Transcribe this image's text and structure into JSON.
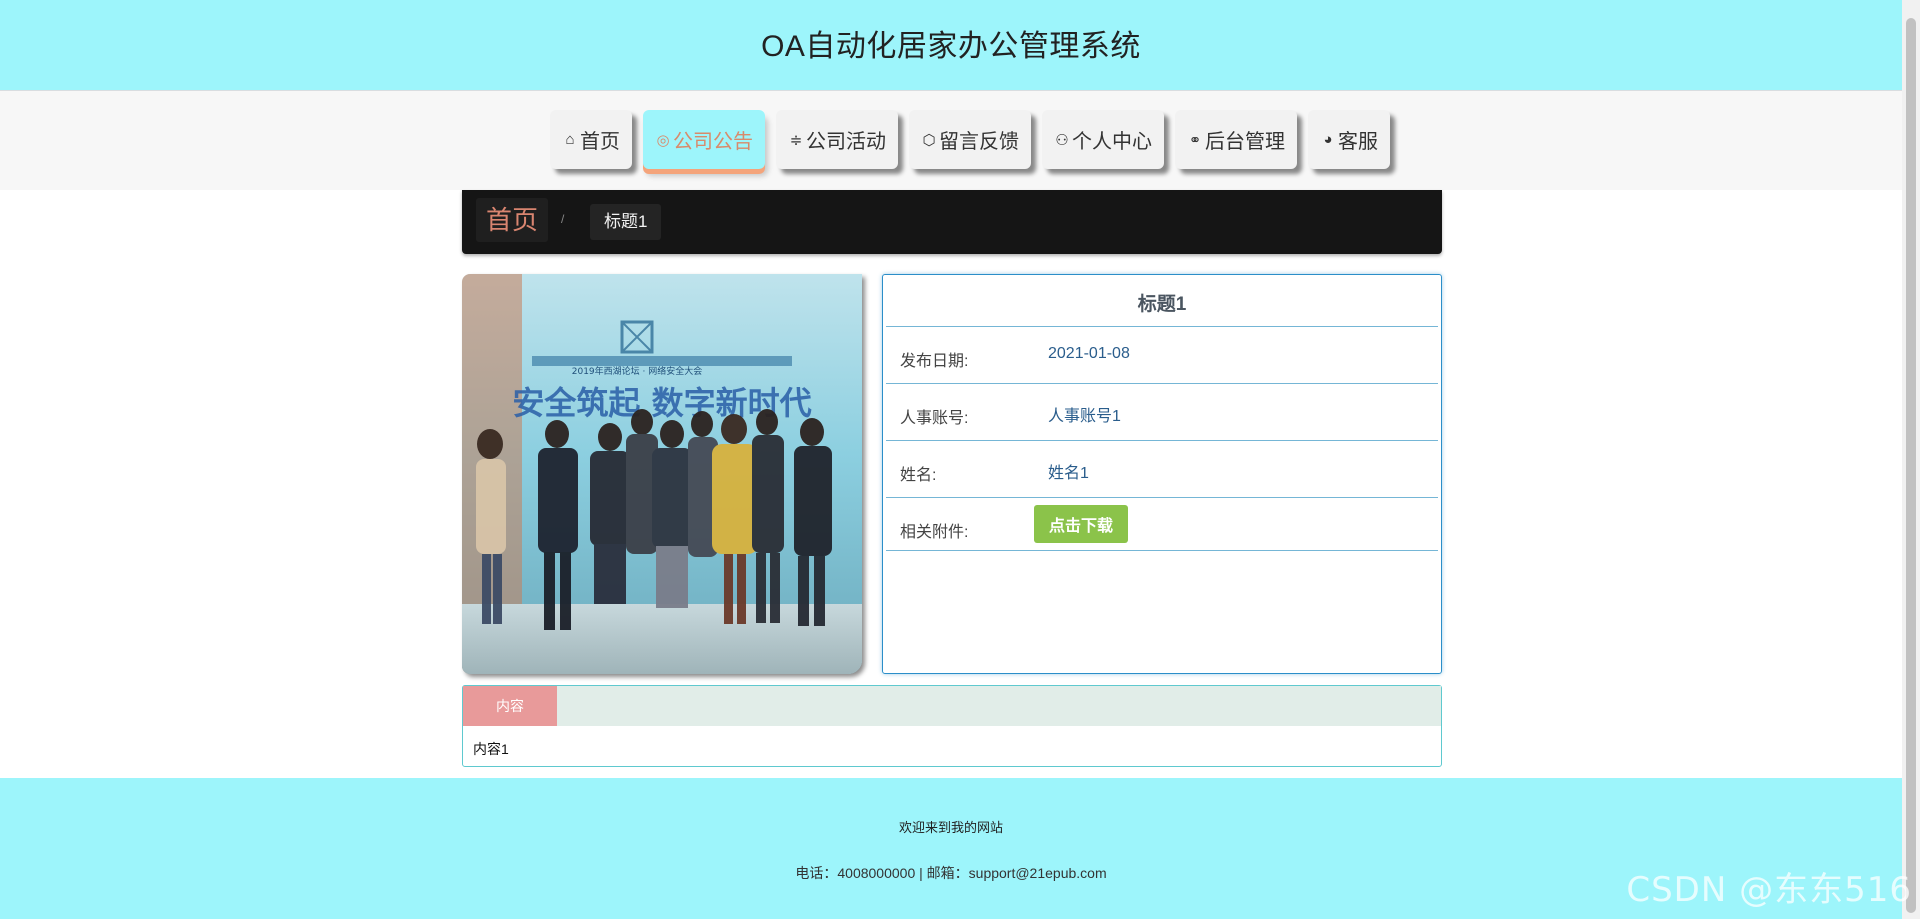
{
  "header": {
    "title": "OA自动化居家办公管理系统"
  },
  "nav": {
    "items": [
      {
        "label": "首页",
        "icon": "home-icon",
        "glyph": "⌂"
      },
      {
        "label": "公司公告",
        "icon": "announcement-icon",
        "glyph": "◎"
      },
      {
        "label": "公司活动",
        "icon": "sliders-icon",
        "glyph": "≑"
      },
      {
        "label": "留言反馈",
        "icon": "cube-icon",
        "glyph": "⬡"
      },
      {
        "label": "个人中心",
        "icon": "user-icon",
        "glyph": "⚇"
      },
      {
        "label": "后台管理",
        "icon": "link-icon",
        "glyph": "⚭"
      },
      {
        "label": "客服",
        "icon": "chat-icon",
        "glyph": "◕"
      }
    ],
    "active": "公司公告",
    "active_color": "#9df5fb"
  },
  "breadcrumb": {
    "home": "首页",
    "separator": "/",
    "current": "标题1"
  },
  "detail": {
    "title": "标题1",
    "rows": [
      {
        "label": "发布日期:",
        "value": "2021-01-08"
      },
      {
        "label": "人事账号:",
        "value": "人事账号1"
      },
      {
        "label": "姓名:",
        "value": "姓名1"
      }
    ],
    "attachment": {
      "label": "相关附件:",
      "button": "点击下载"
    }
  },
  "content": {
    "tab": "内容",
    "text": "内容1"
  },
  "footer": {
    "welcome": "欢迎来到我的网站",
    "contact": "电话：4008000000 | 邮箱：support@21epub.com"
  },
  "watermark": "CSDN @东东516",
  "photo": {
    "banner_title": "2019年西湖论坛 · 网络安全大会",
    "slogan": "安全筑起 数字新时代"
  }
}
